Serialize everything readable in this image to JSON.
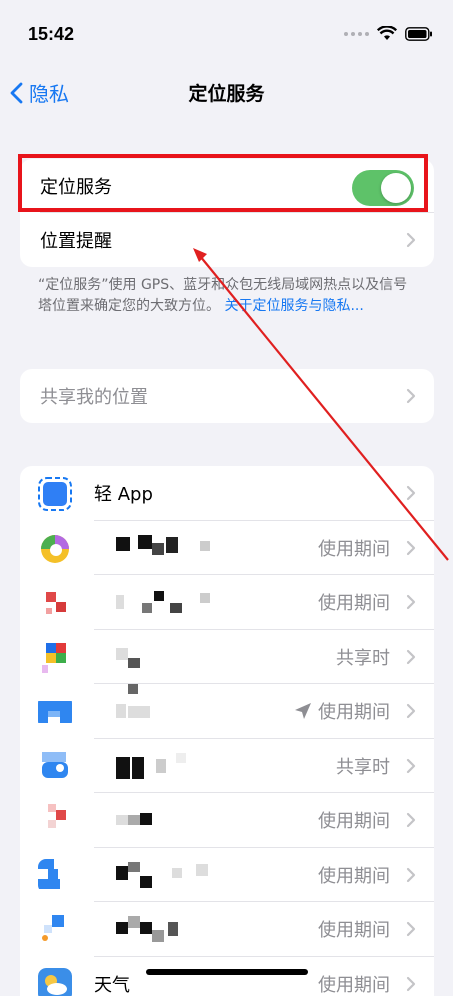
{
  "status_bar": {
    "time": "15:42"
  },
  "nav": {
    "back_label": "隐私",
    "title": "定位服务"
  },
  "main_group": {
    "location_services_label": "定位服务",
    "location_services_on": true,
    "location_alerts_label": "位置提醒"
  },
  "footnote": {
    "text": "“定位服务”使用 GPS、蓝牙和众包无线局域网热点以及信号塔位置来确定您的大致方位。",
    "link": "关于定位服务与隐私..."
  },
  "share_location": {
    "label": "共享我的位置"
  },
  "apps": [
    {
      "name": "轻 App",
      "status": ""
    },
    {
      "name": "",
      "status": "使用期间"
    },
    {
      "name": "",
      "status": "使用期间"
    },
    {
      "name": "",
      "status": "共享时"
    },
    {
      "name": "",
      "status": "使用期间",
      "recent_location_arrow": true
    },
    {
      "name": "",
      "status": "共享时"
    },
    {
      "name": "",
      "status": "使用期间"
    },
    {
      "name": "",
      "status": "使用期间"
    },
    {
      "name": "",
      "status": "使用期间"
    },
    {
      "name": "天气",
      "status": "使用期间"
    }
  ],
  "colors": {
    "accent": "#1778f2",
    "toggle_on": "#5ec269",
    "highlight_box": "#e8141b",
    "annotation_arrow": "#e02020"
  }
}
